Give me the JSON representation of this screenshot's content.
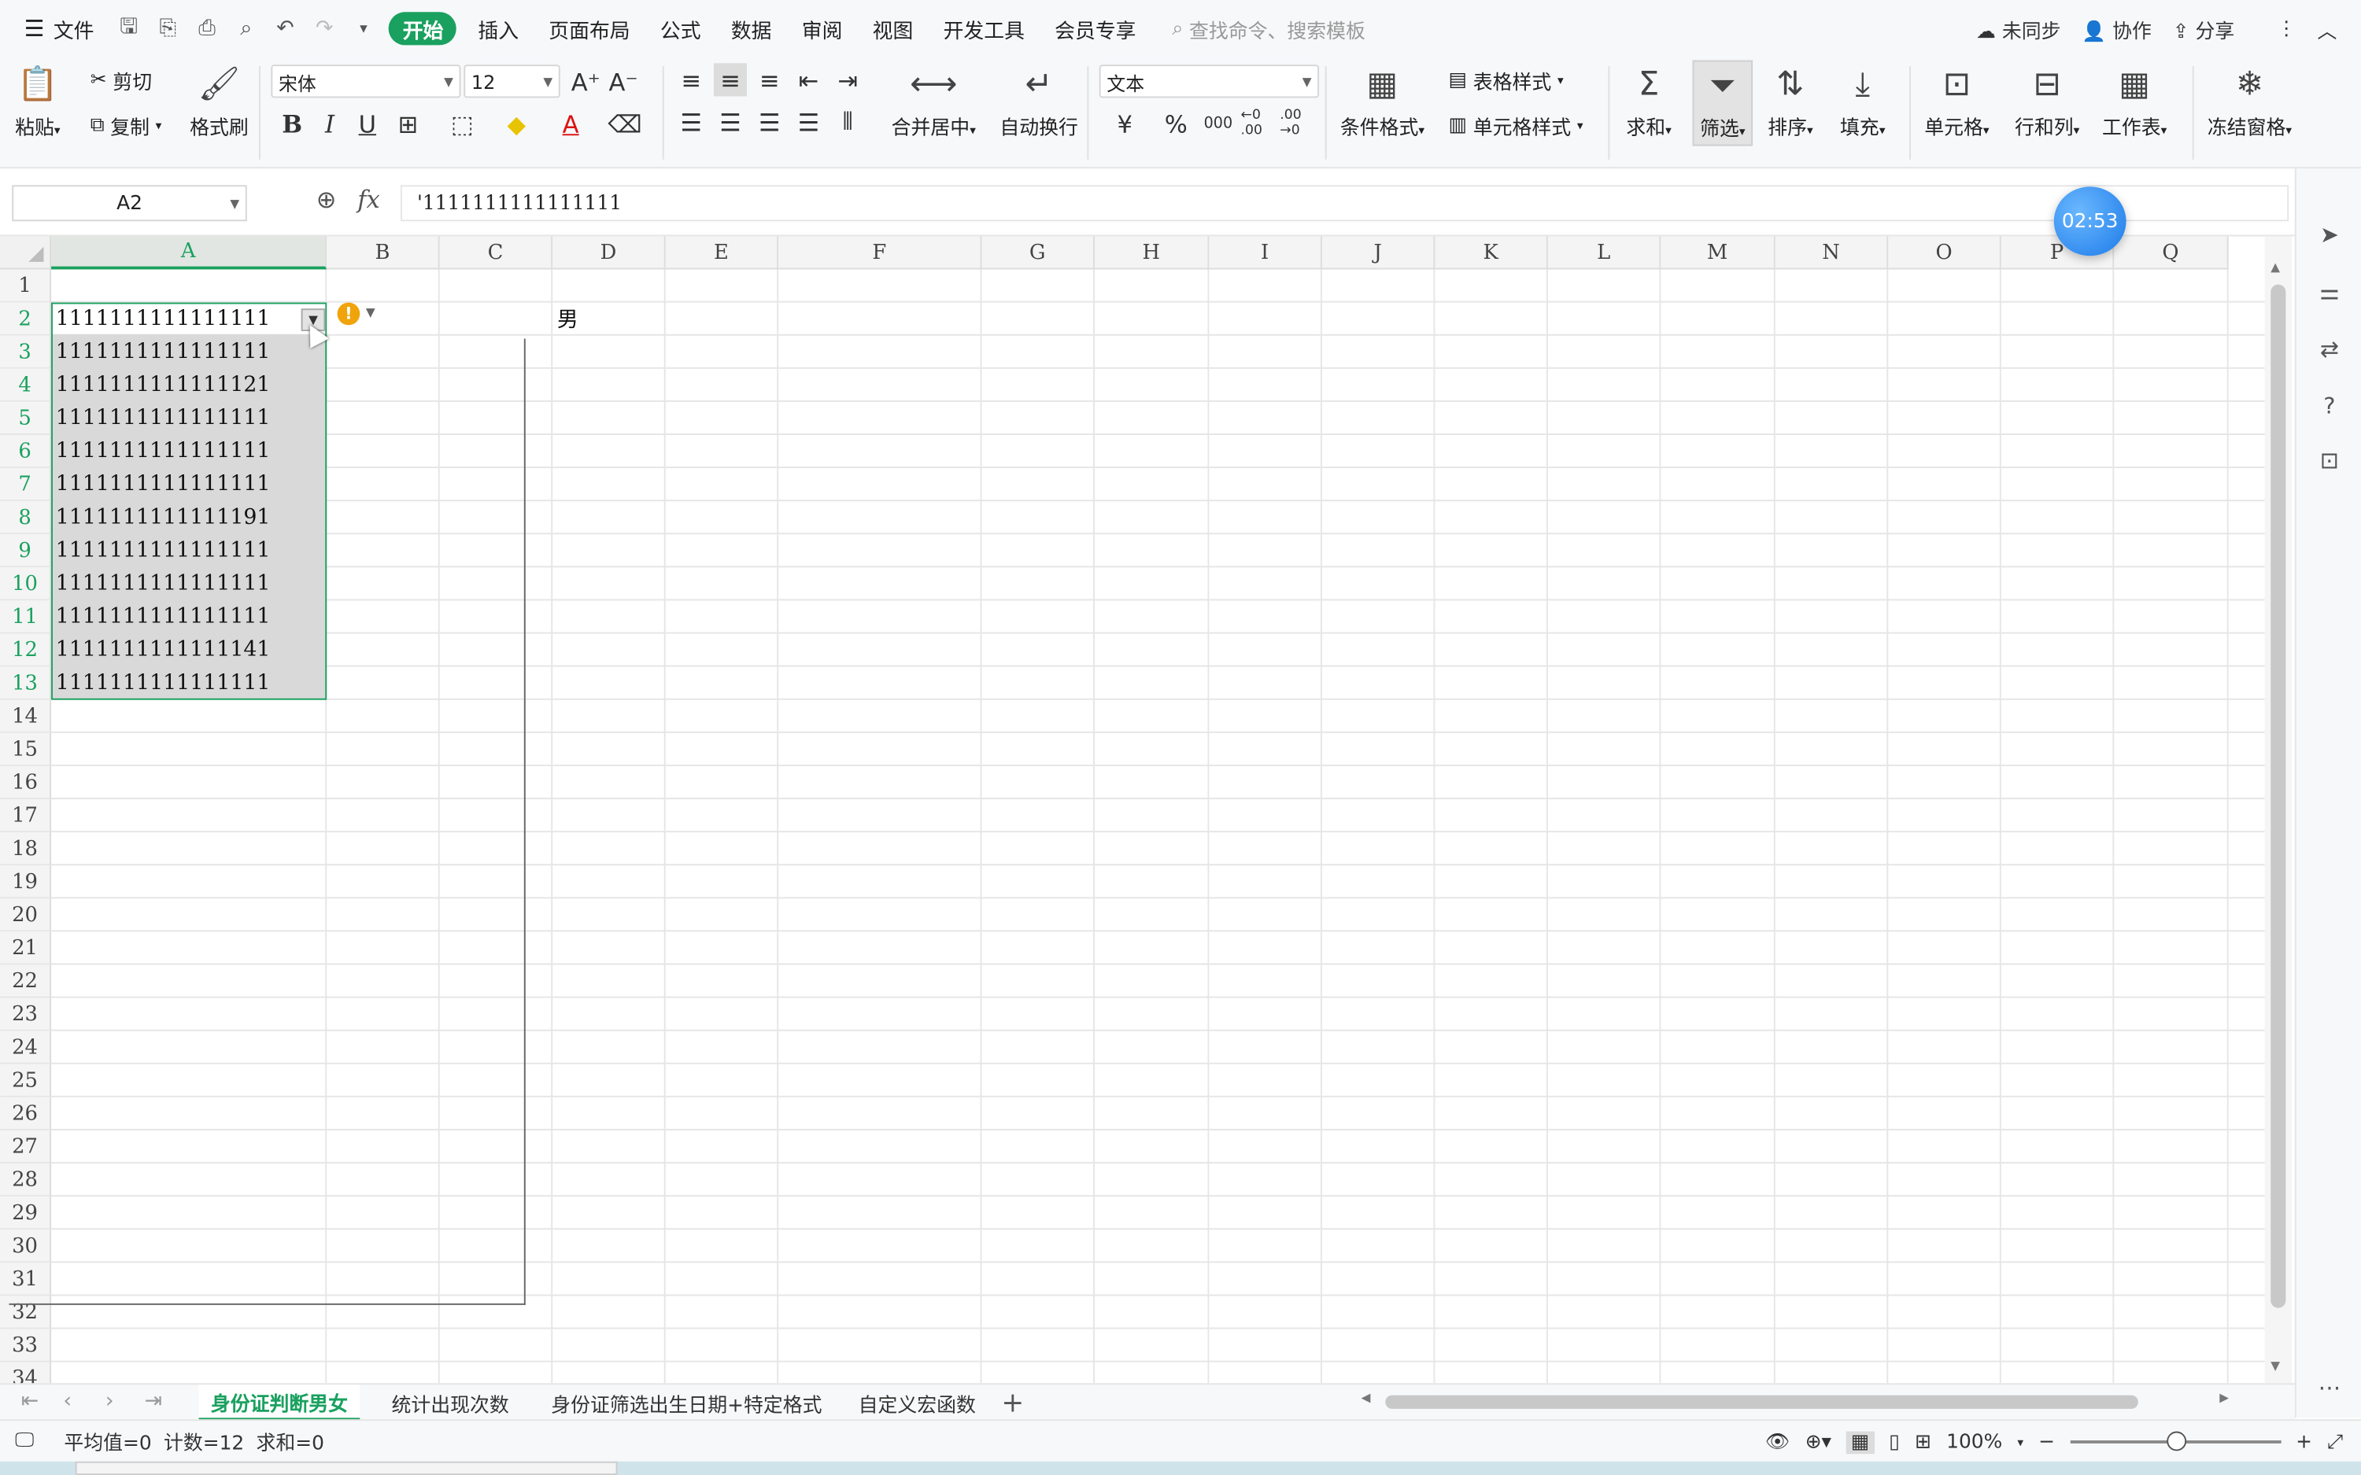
{
  "menubar": {
    "file": "文件",
    "tabs": [
      "开始",
      "插入",
      "页面布局",
      "公式",
      "数据",
      "审阅",
      "视图",
      "开发工具",
      "会员专享"
    ],
    "active_tab": "开始",
    "search_placeholder": "查找命令、搜索模板",
    "sync": "未同步",
    "collab": "协作",
    "share": "分享"
  },
  "ribbon": {
    "paste": "粘贴",
    "cut": "剪切",
    "copy": "复制",
    "format_painter": "格式刷",
    "font_name": "宋体",
    "font_size": "12",
    "merge_center": "合并居中",
    "wrap_text": "自动换行",
    "number_format": "文本",
    "currency": "¥",
    "percent": "%",
    "thousands": "000",
    "inc_decimal": "←0 .00",
    "dec_decimal": ".00 →0",
    "cond_format": "条件格式",
    "table_style": "表格样式",
    "cell_style": "单元格样式",
    "sum": "求和",
    "filter": "筛选",
    "sort": "排序",
    "fill": "填充",
    "cell": "单元格",
    "row_col": "行和列",
    "worksheet": "工作表",
    "freeze": "冻结窗格"
  },
  "formula_bar": {
    "name_box": "A2",
    "content": "'1111111111111111",
    "fx": "fx"
  },
  "timer": "02:53",
  "columns": [
    "A",
    "B",
    "C",
    "D",
    "E",
    "F",
    "G",
    "H",
    "I",
    "J",
    "K",
    "L",
    "M",
    "N",
    "O",
    "P",
    "Q"
  ],
  "rows": [
    "1",
    "2",
    "3",
    "4",
    "5",
    "6",
    "7",
    "8",
    "9",
    "10",
    "11",
    "12",
    "13",
    "14",
    "15",
    "16",
    "17",
    "18",
    "19",
    "20",
    "21",
    "22",
    "23",
    "24",
    "25",
    "26",
    "27",
    "28",
    "29",
    "30",
    "31",
    "32",
    "33",
    "34"
  ],
  "cells_a": [
    "1111111111111111",
    "1111111111111111",
    "1111111111111121",
    "1111111111111111",
    "1111111111111111",
    "1111111111111111",
    "1111111111111191",
    "1111111111111111",
    "1111111111111111",
    "1111111111111111",
    "1111111111111141",
    "1111111111111111"
  ],
  "cell_d2": "男",
  "sheets": [
    "身份证判断男女",
    "统计出现次数",
    "身份证筛选出生日期+特定格式",
    "自定义宏函数"
  ],
  "active_sheet": "身份证判断男女",
  "status": {
    "average": "平均值=0",
    "count": "计数=12",
    "sum": "求和=0",
    "zoom": "100%"
  },
  "colors": {
    "accent": "#1aa15f",
    "selection": "#d9d9d9",
    "warning": "#f0a30a"
  }
}
